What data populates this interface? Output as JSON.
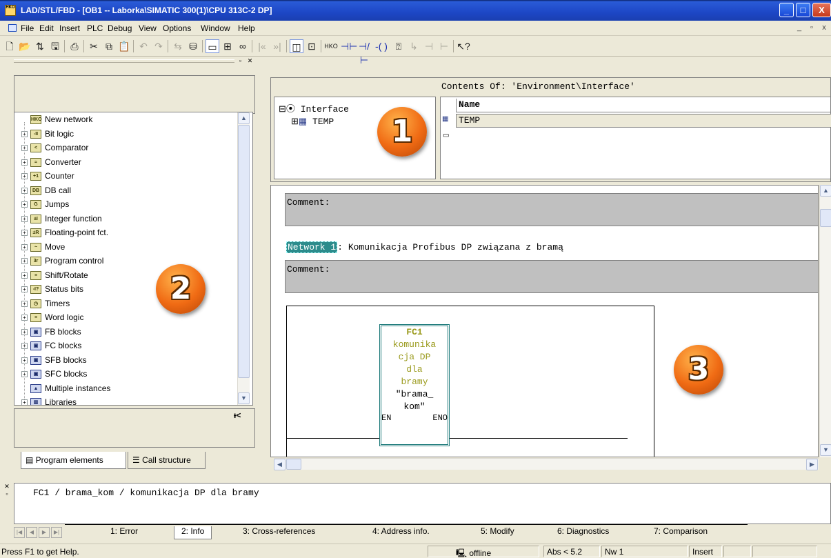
{
  "window": {
    "title": "LAD/STL/FBD  - [OB1 -- Laborka\\SIMATIC 300(1)\\CPU 313C-2 DP]",
    "app_icon_text": "HKO",
    "controls": {
      "minimize": "_",
      "maximize": "□",
      "close": "X"
    }
  },
  "menu": {
    "items": [
      "File",
      "Edit",
      "Insert",
      "PLC",
      "Debug",
      "View",
      "Options",
      "Window",
      "Help"
    ],
    "mdi_controls": {
      "minimize": "_",
      "restore": "▫",
      "close": "x"
    }
  },
  "toolbar": {
    "icons": [
      "new-icon",
      "open-icon",
      "accessible-nodes-icon",
      "save-icon",
      "print-icon",
      "cut-icon",
      "copy-icon",
      "paste-icon",
      "undo-icon",
      "redo-icon",
      "load-icon",
      "compare-icon",
      "overview-icon",
      "network-icon",
      "monitor-icon",
      "prev-icon",
      "next-icon",
      "layout-1-icon",
      "layout-2-icon",
      "new-network-icon",
      "contact-no-icon",
      "contact-nc-icon",
      "coil-icon",
      "empty-box-icon",
      "open-branch-icon",
      "close-branch-icon",
      "connection-icon",
      "help-icon"
    ]
  },
  "left_panel": {
    "tree": [
      {
        "label": "New network",
        "icon": "HKO",
        "expandable": false
      },
      {
        "label": "Bit logic",
        "icon": "-II",
        "expandable": true
      },
      {
        "label": "Comparator",
        "icon": "<",
        "expandable": true
      },
      {
        "label": "Converter",
        "icon": "≈",
        "expandable": true
      },
      {
        "label": "Counter",
        "icon": "+1",
        "expandable": true
      },
      {
        "label": "DB call",
        "icon": "DB",
        "expandable": true
      },
      {
        "label": "Jumps",
        "icon": "G",
        "expandable": true
      },
      {
        "label": "Integer function",
        "icon": "±I",
        "expandable": true
      },
      {
        "label": "Floating-point fct.",
        "icon": "±R",
        "expandable": true
      },
      {
        "label": "Move",
        "icon": "~",
        "expandable": true
      },
      {
        "label": "Program control",
        "icon": "3r",
        "expandable": true
      },
      {
        "label": "Shift/Rotate",
        "icon": "≡",
        "expandable": true
      },
      {
        "label": "Status bits",
        "icon": "-I?",
        "expandable": true
      },
      {
        "label": "Timers",
        "icon": "◷",
        "expandable": true
      },
      {
        "label": "Word logic",
        "icon": "≡",
        "expandable": true
      },
      {
        "label": "FB blocks",
        "icon": "▣",
        "expandable": true
      },
      {
        "label": "FC blocks",
        "icon": "▣",
        "expandable": true
      },
      {
        "label": "SFB blocks",
        "icon": "▣",
        "expandable": true
      },
      {
        "label": "SFC blocks",
        "icon": "▣",
        "expandable": true
      },
      {
        "label": "Multiple instances",
        "icon": "▲",
        "expandable": false
      },
      {
        "label": "Libraries",
        "icon": "▥",
        "expandable": true
      }
    ],
    "corner_icon_text": "ᵼ<",
    "tabs": [
      "Program elements",
      "Call structure"
    ]
  },
  "interface": {
    "root": "Interface",
    "child": "TEMP",
    "contents_label": "Contents Of: 'Environment\\Interface'",
    "column_header": "Name",
    "rows": [
      "TEMP",
      ""
    ]
  },
  "editor": {
    "block_comment_label": "Comment:",
    "network_tag": "Network 1",
    "network_title": ": Komunikacja Profibus DP związana z bramą",
    "network_comment_label": "Comment:",
    "fc_block": {
      "name": "FC1",
      "comment_lines": [
        "komunika",
        "cja DP",
        "dla",
        "bramy"
      ],
      "symbol_lines": [
        "\"brama_",
        "kom\""
      ],
      "en": "EN",
      "eno": "ENO"
    }
  },
  "details": {
    "text": "FC1 / brama_kom / komunikacja DP dla bramy",
    "tabs": [
      "1: Error",
      "2: Info",
      "3: Cross-references",
      "4: Address info.",
      "5: Modify",
      "6: Diagnostics",
      "7: Comparison"
    ],
    "active_tab": "2: Info"
  },
  "status": {
    "help": "Press F1 to get Help.",
    "mode": "offline",
    "abs": "Abs < 5.2",
    "nw": "Nw 1",
    "insert": "Insert"
  },
  "callouts": [
    "1",
    "2",
    "3"
  ]
}
